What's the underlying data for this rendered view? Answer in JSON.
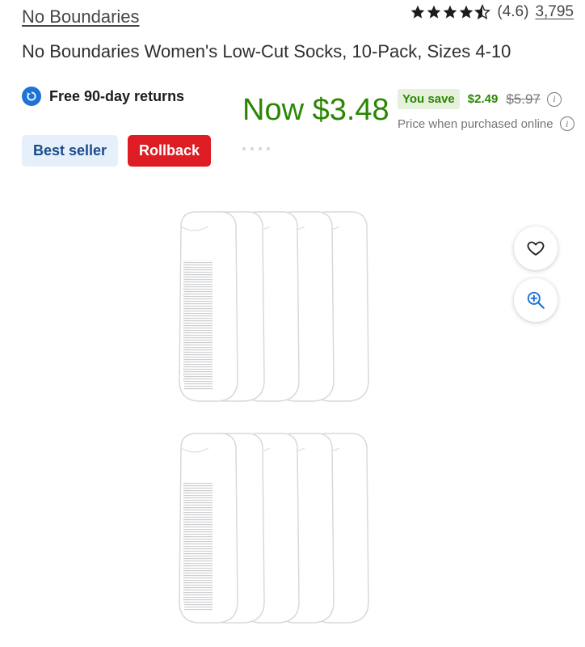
{
  "brand": {
    "name": "No Boundaries"
  },
  "rating": {
    "value_text": "(4.6)",
    "stars": 4.5,
    "review_count": "3,795"
  },
  "product": {
    "title": "No Boundaries Women's Low-Cut Socks, 10-Pack, Sizes 4-10"
  },
  "returns": {
    "label": "Free 90-day returns",
    "icon": "return-arrow-icon"
  },
  "price": {
    "now": "Now $3.48",
    "you_save_label": "You save",
    "save_amount": "$2.49",
    "was": "$5.97",
    "note": "Price when purchased online",
    "accent_color": "#2a8703"
  },
  "badges": {
    "best_seller": "Best seller",
    "rollback": "Rollback"
  },
  "image": {
    "description_icon": "socks-product-image",
    "pack_rows": 2,
    "socks_per_row": 5
  },
  "actions": {
    "favorite_icon": "heart-icon",
    "zoom_icon": "zoom-in-icon"
  },
  "colors": {
    "rollback": "#de1c24",
    "best_seller_bg": "#e6f0fb",
    "link": "#46474a"
  }
}
